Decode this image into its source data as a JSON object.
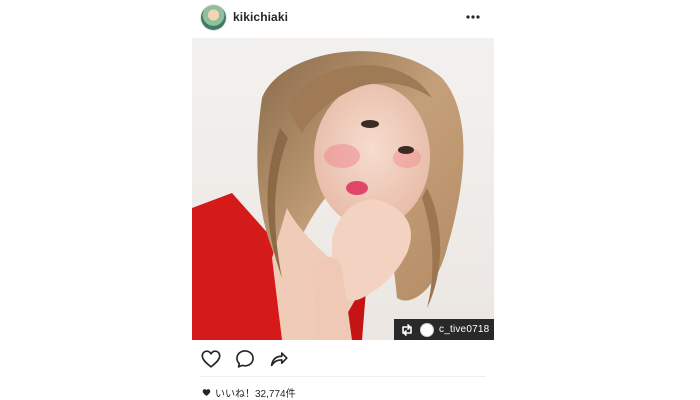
{
  "header": {
    "username": "kikichiaki"
  },
  "repost": {
    "source_username": "c_tive0718"
  },
  "likes": {
    "text": "いいね！32,774件"
  },
  "icons": {
    "more": "more-icon",
    "like": "heart-icon",
    "comment": "comment-icon",
    "share": "share-icon",
    "repost": "repost-icon"
  },
  "colors": {
    "text": "#262626",
    "badge_bg": "#0f0f0f"
  }
}
